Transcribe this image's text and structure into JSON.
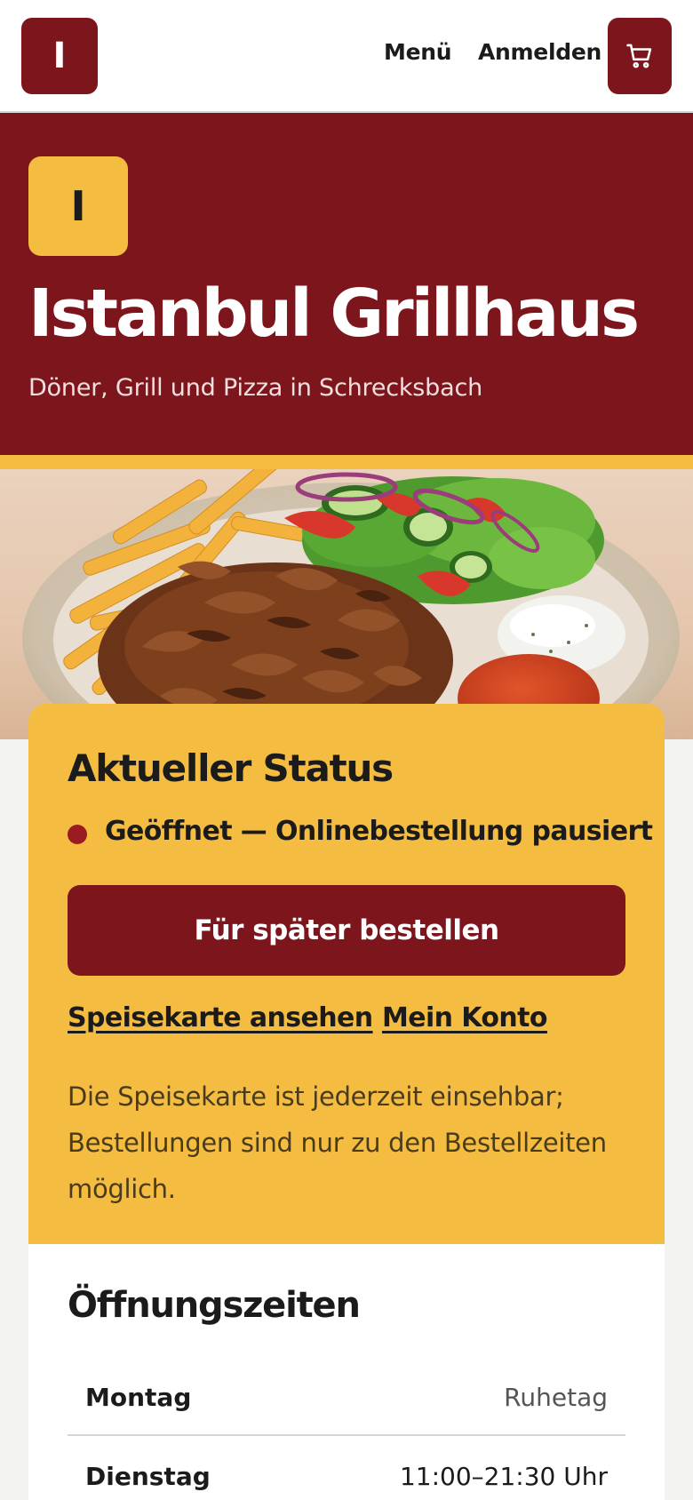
{
  "header": {
    "logo_letter": "I",
    "nav_menu": "Menü",
    "nav_login": "Anmelden",
    "cart_icon": "cart-icon"
  },
  "hero": {
    "badge_letter": "I",
    "title": "Istanbul Grillhaus",
    "subtitle": "Döner, Grill und Pizza in Schrecksbach"
  },
  "status": {
    "title": "Aktueller Status",
    "state": "Geöffnet — Onlinebestellung pausiert",
    "order_button": "Für später bestellen",
    "link_menu": "Speisekarte ansehen",
    "link_account": "Mein Konto",
    "note": "Die Speisekarte ist jederzeit einsehbar; Bestellungen sind nur zu den Bestellzeiten möglich."
  },
  "hours": {
    "title": "Öffnungszeiten",
    "rows": [
      {
        "day": "Montag",
        "time": "Ruhetag"
      },
      {
        "day": "Dienstag",
        "time": "11:00–21:30 Uhr"
      }
    ]
  },
  "colors": {
    "brand": "#7d161c",
    "accent": "#f4bd42"
  }
}
